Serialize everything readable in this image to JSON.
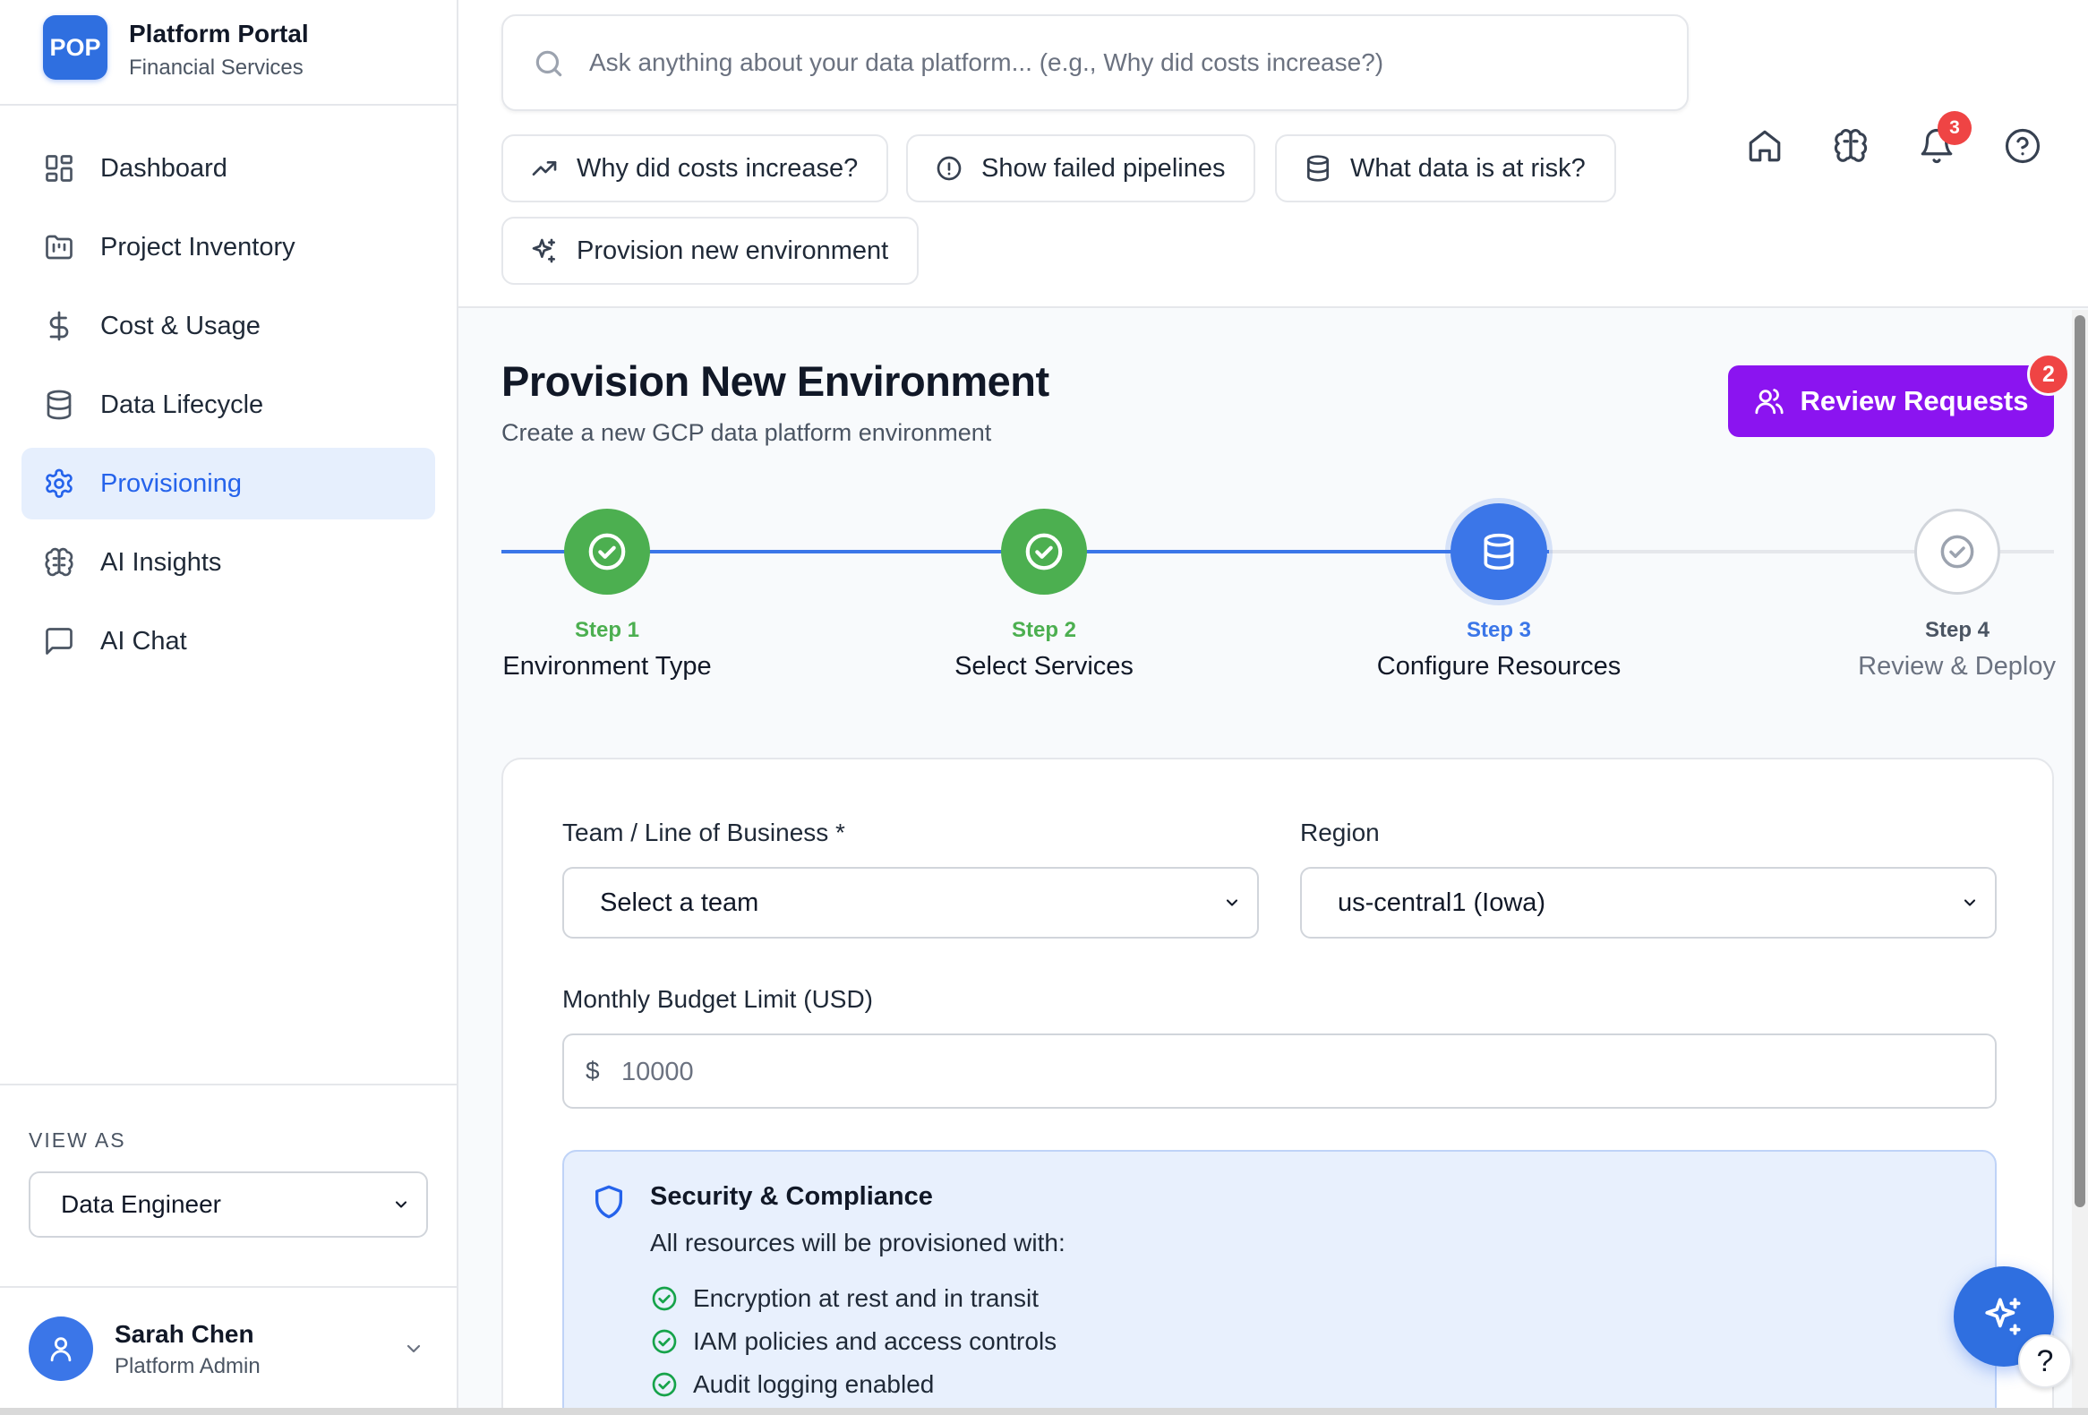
{
  "brand": {
    "logo": "POP",
    "name": "Platform Portal",
    "subtitle": "Financial Services"
  },
  "sidebar": {
    "items": [
      {
        "label": "Dashboard",
        "icon": "layout-grid-icon",
        "active": false
      },
      {
        "label": "Project Inventory",
        "icon": "folder-kanban-icon",
        "active": false
      },
      {
        "label": "Cost & Usage",
        "icon": "dollar-icon",
        "active": false
      },
      {
        "label": "Data Lifecycle",
        "icon": "database-icon",
        "active": false
      },
      {
        "label": "Provisioning",
        "icon": "gear-icon",
        "active": true
      },
      {
        "label": "AI Insights",
        "icon": "brain-icon",
        "active": false
      },
      {
        "label": "AI Chat",
        "icon": "chat-icon",
        "active": false
      }
    ],
    "view_as_label": "VIEW AS",
    "view_as_value": "Data Engineer"
  },
  "user": {
    "name": "Sarah Chen",
    "role": "Platform Admin"
  },
  "search": {
    "placeholder": "Ask anything about your data platform... (e.g., Why did costs increase?)"
  },
  "quick_actions": [
    "Why did costs increase?",
    "Show failed pipelines",
    "What data is at risk?",
    "Provision new environment"
  ],
  "header": {
    "notification_count": "3"
  },
  "page": {
    "title": "Provision New Environment",
    "subtitle": "Create a new GCP data platform environment",
    "review_button": "Review Requests",
    "review_count": "2"
  },
  "steps": [
    {
      "num": "Step 1",
      "label": "Environment Type",
      "status": "complete"
    },
    {
      "num": "Step 2",
      "label": "Select Services",
      "status": "complete"
    },
    {
      "num": "Step 3",
      "label": "Configure Resources",
      "status": "current"
    },
    {
      "num": "Step 4",
      "label": "Review & Deploy",
      "status": "pending"
    }
  ],
  "form": {
    "team_label": "Team / Line of Business *",
    "team_value": "Select a team",
    "region_label": "Region",
    "region_value": "us-central1 (Iowa)",
    "budget_label": "Monthly Budget Limit (USD)",
    "budget_currency": "$",
    "budget_placeholder": "10000"
  },
  "security": {
    "title": "Security & Compliance",
    "description": "All resources will be provisioned with:",
    "items": [
      "Encryption at rest and in transit",
      "IAM policies and access controls",
      "Audit logging enabled"
    ]
  },
  "help_label": "?",
  "colors": {
    "primary": "#2f6fe0",
    "active_nav_bg": "#e6effd",
    "step_complete": "#4caf50",
    "review_button": "#8b14f0",
    "badge": "#ef4444",
    "security_bg": "#e8f0fd"
  }
}
